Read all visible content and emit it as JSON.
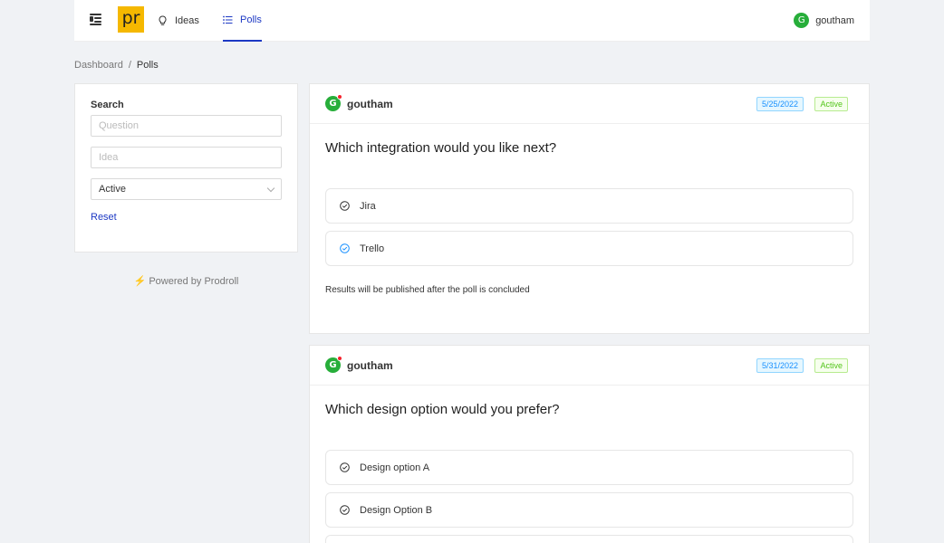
{
  "header": {
    "logo_text": "pr",
    "nav": [
      {
        "label": "Ideas",
        "icon": "bulb-icon",
        "active": false
      },
      {
        "label": "Polls",
        "icon": "list-icon",
        "active": true
      }
    ],
    "user": {
      "initial": "G",
      "name": "goutham"
    }
  },
  "breadcrumb": {
    "root": "Dashboard",
    "separator": "/",
    "current": "Polls"
  },
  "filters": {
    "title": "Search",
    "question_placeholder": "Question",
    "idea_placeholder": "Idea",
    "status_value": "Active",
    "reset_label": "Reset"
  },
  "footer": {
    "powered_by": "Powered by Prodroll",
    "icon": "lightning-icon"
  },
  "polls": [
    {
      "author": "goutham",
      "initial": "G",
      "date": "5/25/2022",
      "status": "Active",
      "question": "Which integration would you like next?",
      "options": [
        {
          "label": "Jira",
          "selected": false
        },
        {
          "label": "Trello",
          "selected": true
        }
      ],
      "note": "Results will be published after the poll is concluded"
    },
    {
      "author": "goutham",
      "initial": "G",
      "date": "5/31/2022",
      "status": "Active",
      "question": "Which design option would you prefer?",
      "options": [
        {
          "label": "Design option A",
          "selected": false
        },
        {
          "label": "Design Option B",
          "selected": false
        },
        {
          "label": "",
          "selected": false
        }
      ]
    }
  ],
  "colors": {
    "accent": "#1d39c4",
    "logo_bg": "#f5b800",
    "avatar": "#27ae3a",
    "check_default": "#333333",
    "check_selected": "#1890ff"
  }
}
